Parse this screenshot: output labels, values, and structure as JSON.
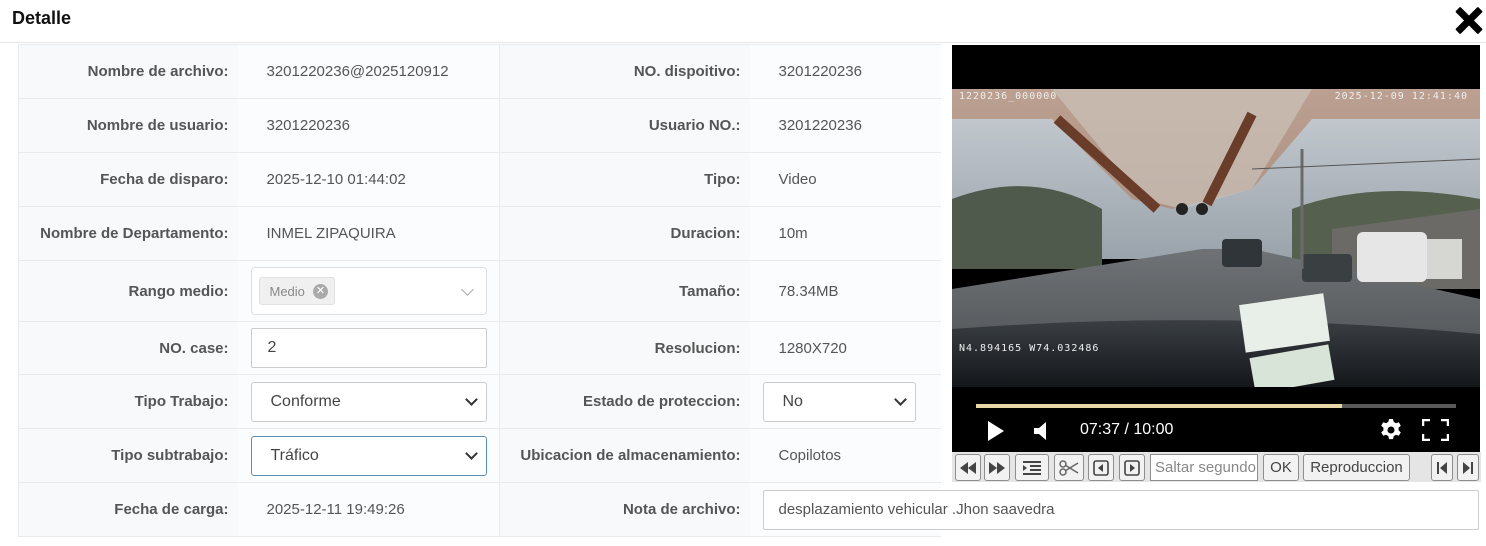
{
  "dialog": {
    "title": "Detalle"
  },
  "left": {
    "rows": [
      {
        "label": "Nombre de archivo:",
        "value": "3201220236@2025120912"
      },
      {
        "label": "Nombre de usuario:",
        "value": "3201220236"
      },
      {
        "label": "Fecha de disparo:",
        "value": "2025-12-10 01:44:02"
      },
      {
        "label": "Nombre de Departamento:",
        "value": "INMEL ZIPAQUIRA"
      },
      {
        "label": "Rango medio:",
        "tag": "Medio"
      },
      {
        "label": "NO. case:",
        "value": "2"
      },
      {
        "label": "Tipo Trabajo:",
        "value": "Conforme"
      },
      {
        "label": "Tipo subtrabajo:",
        "value": "Tráfico"
      },
      {
        "label": "Fecha de carga:",
        "value": "2025-12-11 19:49:26"
      }
    ]
  },
  "right": {
    "rows": [
      {
        "label": "NO. dispoitivo:",
        "value": "3201220236"
      },
      {
        "label": "Usuario NO.:",
        "value": "3201220236"
      },
      {
        "label": "Tipo:",
        "value": "Video"
      },
      {
        "label": "Duracion:",
        "value": "10m"
      },
      {
        "label": "Tamaño:",
        "value": "78.34MB"
      },
      {
        "label": "Resolucion:",
        "value": "1280X720"
      },
      {
        "label": "Estado de proteccion:",
        "value": "No"
      },
      {
        "label": "Ubicacion de almacenamiento:",
        "value": "Copilotos"
      },
      {
        "label": "Nota de archivo:",
        "value": "desplazamiento vehicular .Jhon saavedra"
      }
    ]
  },
  "video": {
    "osd_top_left": "1220236_000000",
    "osd_top_right": "2025-12-09 12:41:40",
    "osd_bottom_left": "N4.894165 W74.032486",
    "time": "07:37 / 10:00",
    "progress": 0.762,
    "icons": [
      "play-icon",
      "volume-icon",
      "gear-icon",
      "fullscreen-icon"
    ]
  },
  "toolbar": {
    "buttons": [
      "rewind-icon",
      "fast-forward-icon",
      "indent-icon",
      "scissors-icon",
      "frame-back-icon",
      "frame-forward-icon"
    ],
    "seek_placeholder": "Saltar segundo",
    "ok_label": "OK",
    "replay_label": "Reproduccion",
    "nav": [
      "skip-start-icon",
      "skip-end-icon"
    ]
  },
  "colors": {
    "progress_fill": "#e8d8a8",
    "label_bg": "#f8f9fb"
  }
}
